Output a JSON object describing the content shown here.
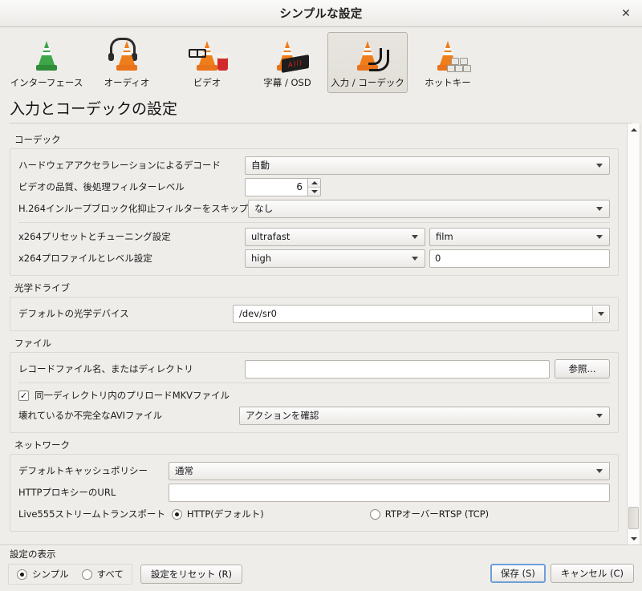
{
  "window": {
    "title": "シンプルな設定",
    "close_icon": "close-icon"
  },
  "toolbar": {
    "items": [
      {
        "label": "インターフェース",
        "icon": "vlc-cone-green-icon",
        "selected": false
      },
      {
        "label": "オーディオ",
        "icon": "vlc-cone-headphones-icon",
        "selected": false
      },
      {
        "label": "ビデオ",
        "icon": "vlc-cone-glasses-popcorn-icon",
        "selected": false
      },
      {
        "label": "字幕 / OSD",
        "icon": "vlc-cone-subtitle-icon",
        "selected": false
      },
      {
        "label": "入力 / コーデック",
        "icon": "vlc-cone-cables-icon",
        "selected": true
      },
      {
        "label": "ホットキー",
        "icon": "vlc-cone-keyboard-icon",
        "selected": false
      }
    ]
  },
  "page": {
    "heading": "入力とコーデックの設定"
  },
  "sections": {
    "codec": {
      "title": "コーデック",
      "hw_decode": {
        "label": "ハードウェアアクセラレーションによるデコード",
        "value": "自動"
      },
      "video_quality": {
        "label": "ビデオの品質、後処理フィルターレベル",
        "value": "6"
      },
      "h264_skip": {
        "label": "H.264インループブロック化抑止フィルターをスキップ",
        "value": "なし"
      },
      "x264_preset": {
        "label": "x264プリセットとチューニング設定",
        "value": "ultrafast",
        "value2": "film"
      },
      "x264_profile": {
        "label": "x264プロファイルとレベル設定",
        "value": "high",
        "value2": "0"
      }
    },
    "optical": {
      "title": "光学ドライブ",
      "device": {
        "label": "デフォルトの光学デバイス",
        "value": "/dev/sr0"
      }
    },
    "file": {
      "title": "ファイル",
      "record_path": {
        "label": "レコードファイル名、またはディレクトリ",
        "value": "",
        "placeholder": ""
      },
      "browse_button": "参照...",
      "preload_mkv": {
        "label": "同一ディレクトリ内のプリロードMKVファイル",
        "checked": true,
        "mark": "✓"
      },
      "broken_avi": {
        "label": "壊れているか不完全なAVIファイル",
        "value": "アクションを確認"
      }
    },
    "network": {
      "title": "ネットワーク",
      "cache_policy": {
        "label": "デフォルトキャッシュポリシー",
        "value": "通常"
      },
      "http_proxy": {
        "label": "HTTPプロキシーのURL",
        "value": "",
        "placeholder": ""
      },
      "live555": {
        "label": "Live555ストリームトランスポート",
        "option_http": "HTTP(デフォルト)",
        "option_rtp": "RTPオーバーRTSP (TCP)",
        "selected": "http"
      }
    }
  },
  "bottom": {
    "show_label": "設定の表示",
    "mode_simple": "シンプル",
    "mode_all": "すべて",
    "mode_selected": "simple",
    "reset_button": "設定をリセット (R)",
    "save_button": "保存 (S)",
    "cancel_button": "キャンセル (C)"
  }
}
